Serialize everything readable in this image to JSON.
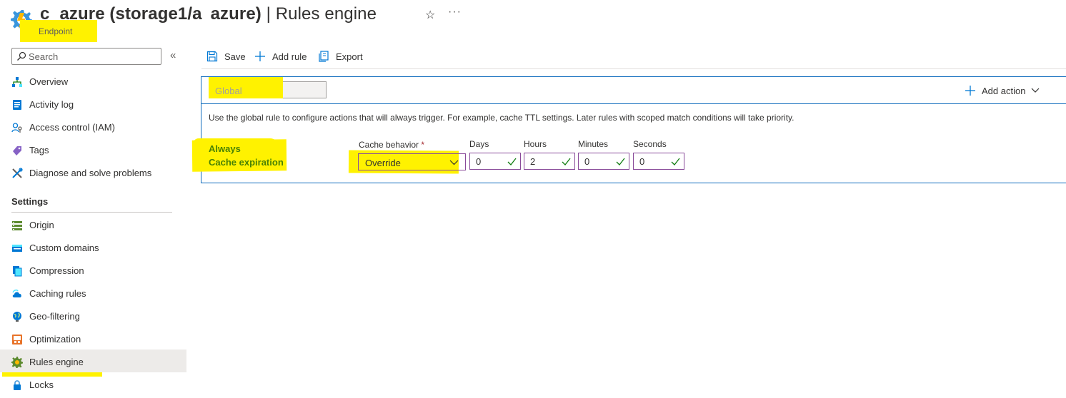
{
  "header": {
    "title_prefix": "c",
    "title_name": "azure (storage1/a",
    "title_name2": "azure)",
    "title_suffix": " | Rules engine",
    "subtitle": "Endpoint",
    "star_glyph": "☆",
    "more_glyph": "···"
  },
  "sidebar": {
    "search_placeholder": "Search",
    "collapse_glyph": "«",
    "items": [
      {
        "label": "Overview",
        "icon": "overview-icon"
      },
      {
        "label": "Activity log",
        "icon": "activity-log-icon"
      },
      {
        "label": "Access control (IAM)",
        "icon": "iam-icon"
      },
      {
        "label": "Tags",
        "icon": "tag-icon"
      },
      {
        "label": "Diagnose and solve problems",
        "icon": "wrench-icon"
      }
    ],
    "section_title": "Settings",
    "settings_items": [
      {
        "label": "Origin",
        "icon": "origin-icon"
      },
      {
        "label": "Custom domains",
        "icon": "custom-domains-icon"
      },
      {
        "label": "Compression",
        "icon": "compression-icon"
      },
      {
        "label": "Caching rules",
        "icon": "cloud-icon"
      },
      {
        "label": "Geo-filtering",
        "icon": "globe-icon"
      },
      {
        "label": "Optimization",
        "icon": "optimization-icon"
      },
      {
        "label": "Rules engine",
        "icon": "gear-icon",
        "active": true
      },
      {
        "label": "Locks",
        "icon": "lock-icon"
      }
    ]
  },
  "toolbar": {
    "save_label": "Save",
    "add_rule_label": "Add rule",
    "export_label": "Export"
  },
  "rule": {
    "name": "Global",
    "add_action_label": "Add action",
    "description": "Use the global rule to configure actions that will always trigger. For example, cache TTL settings. Later rules with scoped match conditions will take priority.",
    "condition_line1": "Always",
    "condition_line2": "Cache expiration",
    "cache_behavior_label": "Cache behavior",
    "required_mark": "*",
    "cache_behavior_value": "Override",
    "days_label": "Days",
    "days_value": "0",
    "hours_label": "Hours",
    "hours_value": "2",
    "minutes_label": "Minutes",
    "minutes_value": "0",
    "seconds_label": "Seconds",
    "seconds_value": "0"
  },
  "colors": {
    "accent": "#0f6cbd",
    "highlight": "#fff200",
    "condition_green": "#498205",
    "field_border": "#8a4b9a",
    "check_green": "#107c10"
  }
}
